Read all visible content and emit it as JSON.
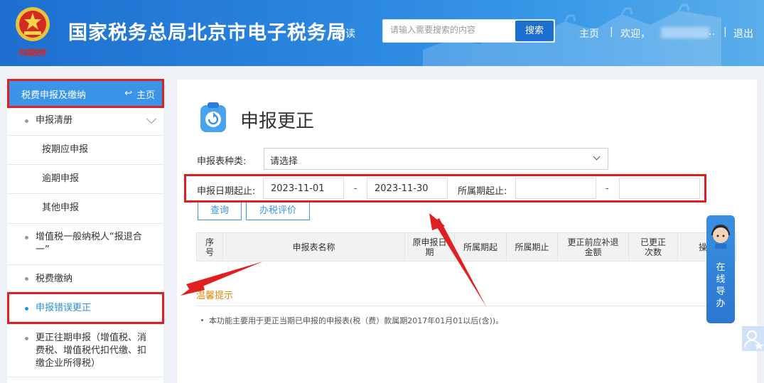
{
  "header": {
    "emblem_text": "中国税务",
    "title": "国家税务总局北京市电子税务局",
    "read_link": "阅读",
    "search_placeholder": "请输入需要搜索的内容",
    "search_button": "搜索",
    "home": "主页",
    "sep": "|",
    "welcome": "欢迎，",
    "user_ellipsis": "..",
    "logout": "退出"
  },
  "sidebar": {
    "head_title": "税费申报及缴纳",
    "head_home": "主页",
    "items": [
      {
        "label": "申报清册"
      },
      {
        "label": "按期应申报"
      },
      {
        "label": "逾期申报"
      },
      {
        "label": "其他申报"
      },
      {
        "label": "增值税一般纳税人“报退合一”"
      },
      {
        "label": "税费缴纳"
      },
      {
        "label": "申报错误更正"
      },
      {
        "label": "更正往期申报（增值税、消费税、增值税代扣代缴、扣缴企业所得税）"
      }
    ]
  },
  "main": {
    "title": "申报更正",
    "form_type_label": "申报表种类:",
    "form_type_value": "请选择",
    "date_label": "申报日期起止:",
    "date_start": "2023-11-01",
    "date_end": "2023-11-30",
    "dash": "-",
    "period_label": "所属期起止:",
    "period_start": "",
    "period_end": "",
    "query_button": "查询",
    "eval_button": "办税评价",
    "columns": [
      "序号",
      "申报表名称",
      "原申报日期",
      "所属期起",
      "所属期止",
      "更正前应补退金额",
      "已更正次数",
      "操"
    ],
    "tip_title": "温馨提示",
    "tip_text": "本功能主要用于更正当期已申报的申报表(税（费）款属期2017年01月01以后(含))。"
  },
  "widgets": {
    "guide_text": "在线导办"
  }
}
